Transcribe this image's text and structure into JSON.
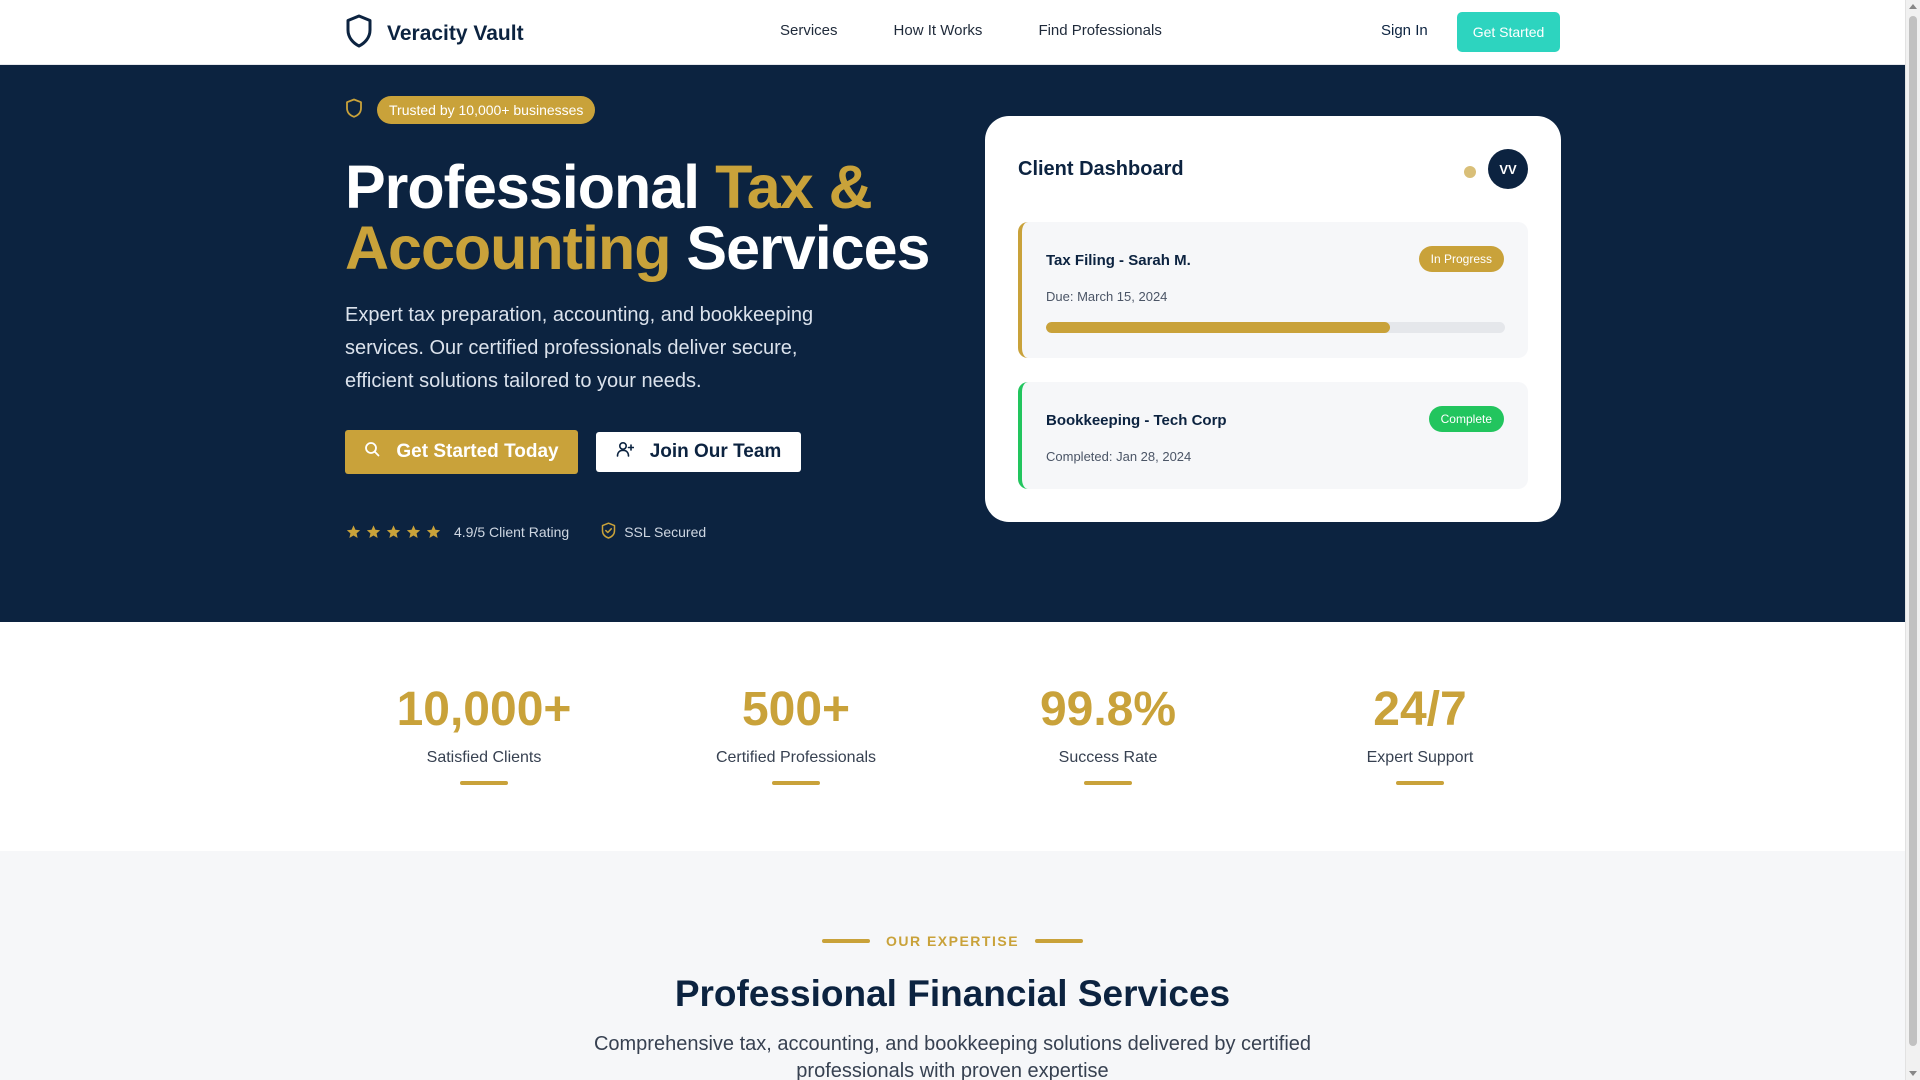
{
  "nav": {
    "brand": "Veracity Vault",
    "links": [
      "Services",
      "How It Works",
      "Find Professionals"
    ],
    "sign_in": "Sign In",
    "cta": "Get Started"
  },
  "hero": {
    "badge": "Trusted by 10,000+ businesses",
    "title_part1": "Professional ",
    "title_gold1": "Tax &",
    "title_gold2": "Accounting",
    "title_part2": " Services",
    "subtitle": "Expert tax preparation, accounting, and bookkeeping services. Our certified professionals deliver secure, efficient solutions tailored to your needs.",
    "primary_button": "Get Started Today",
    "secondary_button": "Join Our Team",
    "rating_stars": 5,
    "rating_text": "4.9/5 Client Rating",
    "ssl_text": "SSL Secured"
  },
  "dashboard": {
    "title": "Client Dashboard",
    "avatar_initials": "VV",
    "tasks": [
      {
        "name": "Tax Filing - Sarah M.",
        "date": "Due: March 15, 2024",
        "status": "In Progress",
        "progress": 0.75
      },
      {
        "name": "Bookkeeping - Tech Corp",
        "date": "Completed: Jan 28, 2024",
        "status": "Complete"
      }
    ]
  },
  "stats": [
    {
      "value": "10,000+",
      "label": "Satisfied Clients"
    },
    {
      "value": "500+",
      "label": "Certified Professionals"
    },
    {
      "value": "99.8%",
      "label": "Success Rate"
    },
    {
      "value": "24/7",
      "label": "Expert Support"
    }
  ],
  "services": {
    "eyebrow": "OUR EXPERTISE",
    "title": "Professional Financial Services",
    "subtitle": "Comprehensive tax, accounting, and bookkeeping solutions delivered by certified professionals with proven expertise"
  },
  "colors": {
    "navy": "#0c2340",
    "gold": "#c9a23a",
    "teal": "#2dd4bf",
    "green": "#22c55e"
  },
  "icons": {
    "brand": "shield-icon",
    "badge": "shield-icon",
    "primary_button": "search-icon",
    "secondary_button": "user-plus-icon",
    "rating": "star-icon",
    "ssl": "shield-check-icon"
  }
}
